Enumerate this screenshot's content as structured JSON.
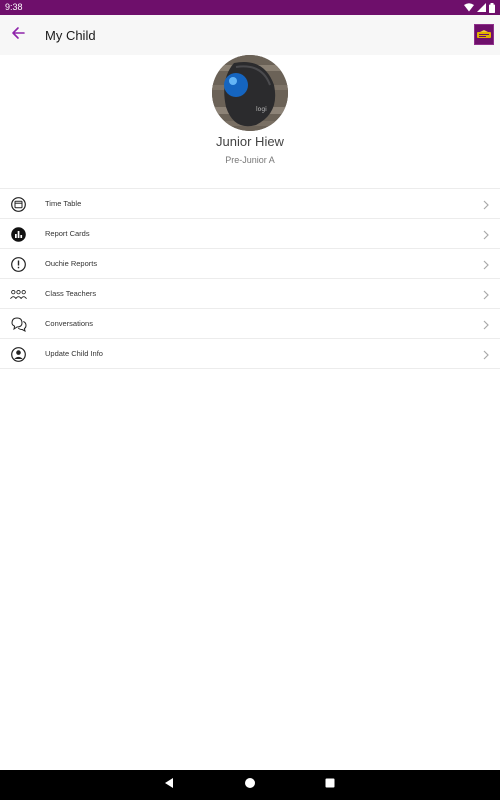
{
  "status_bar": {
    "time": "9:38",
    "icons": [
      "wifi-icon",
      "signal-icon",
      "battery-icon"
    ]
  },
  "app_bar": {
    "title": "My Child",
    "back_icon": "arrow-back-icon",
    "logo_icon": "school-logo-icon"
  },
  "profile": {
    "name": "Junior Hiew",
    "class_name": "Pre-Junior A",
    "avatar_icon": "child-photo"
  },
  "menu": {
    "items": [
      {
        "label": "Time Table",
        "icon": "calendar-icon"
      },
      {
        "label": "Report Cards",
        "icon": "bar-chart-icon"
      },
      {
        "label": "Ouchie Reports",
        "icon": "alert-icon"
      },
      {
        "label": "Class Teachers",
        "icon": "group-icon"
      },
      {
        "label": "Conversations",
        "icon": "chat-icon"
      },
      {
        "label": "Update Child Info",
        "icon": "account-circle-icon"
      }
    ]
  },
  "nav_bar": {
    "buttons": [
      "back-triangle-icon",
      "home-circle-icon",
      "recents-square-icon"
    ]
  },
  "colors": {
    "brand": "#6e0f6b",
    "accent": "#8e24aa",
    "app_bar_bg": "#f7f7f7",
    "divider": "#ececec"
  }
}
